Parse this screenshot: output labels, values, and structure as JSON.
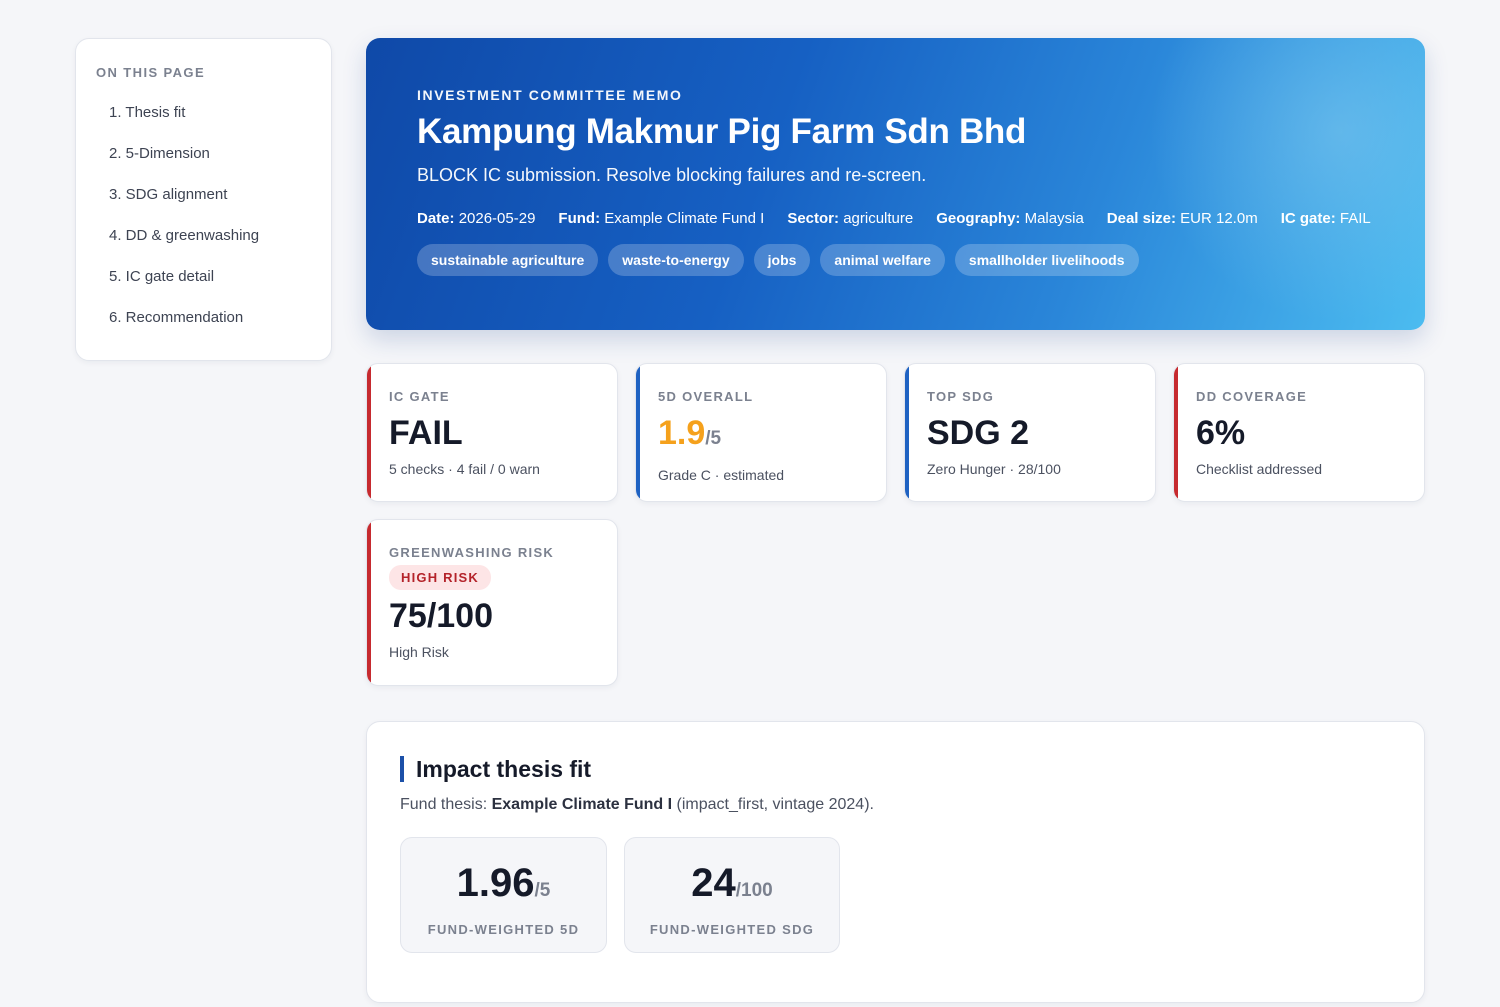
{
  "toc": {
    "title": "ON THIS PAGE",
    "items": [
      "1. Thesis fit",
      "2. 5-Dimension",
      "3. SDG alignment",
      "4. DD & greenwashing",
      "5. IC gate detail",
      "6. Recommendation"
    ]
  },
  "hero": {
    "eyebrow": "INVESTMENT COMMITTEE MEMO",
    "title": "Kampung Makmur Pig Farm Sdn Bhd",
    "subtitle": "BLOCK IC submission. Resolve blocking failures and re-screen.",
    "meta": [
      {
        "label": "Date:",
        "value": "2026-05-29"
      },
      {
        "label": "Fund:",
        "value": "Example Climate Fund I"
      },
      {
        "label": "Sector:",
        "value": "agriculture"
      },
      {
        "label": "Geography:",
        "value": "Malaysia"
      },
      {
        "label": "Deal size:",
        "value": "EUR 12.0m"
      },
      {
        "label": "IC gate:",
        "value": "FAIL"
      }
    ],
    "tags": [
      "sustainable agriculture",
      "waste-to-energy",
      "jobs",
      "animal welfare",
      "smallholder livelihoods"
    ]
  },
  "cards": {
    "ic_gate": {
      "label": "IC GATE",
      "value": "FAIL",
      "sub": "5 checks · 4 fail / 0 warn"
    },
    "overall_5d": {
      "label": "5D OVERALL",
      "value": "1.9",
      "denom": "/5",
      "sub": "Grade C · estimated"
    },
    "top_sdg": {
      "label": "TOP SDG",
      "value": "SDG 2",
      "sub": "Zero Hunger · 28/100"
    },
    "dd_coverage": {
      "label": "DD COVERAGE",
      "value": "6%",
      "sub": "Checklist addressed"
    },
    "greenwashing": {
      "label": "GREENWASHING RISK",
      "badge": "HIGH RISK",
      "value": "75/100",
      "sub": "High Risk"
    }
  },
  "colors": {
    "accent_red": "#c62a2f",
    "accent_blue": "#1f62c2",
    "score_orange": "#f5a11c"
  },
  "thesis": {
    "title": "Impact thesis fit",
    "desc_prefix": "Fund thesis: ",
    "fund_name": "Example Climate Fund I",
    "desc_suffix": " (impact_first, vintage 2024).",
    "stats": [
      {
        "value": "1.96",
        "denom": "/5",
        "label": "FUND-WEIGHTED 5D"
      },
      {
        "value": "24",
        "denom": "/100",
        "label": "FUND-WEIGHTED SDG"
      }
    ]
  }
}
